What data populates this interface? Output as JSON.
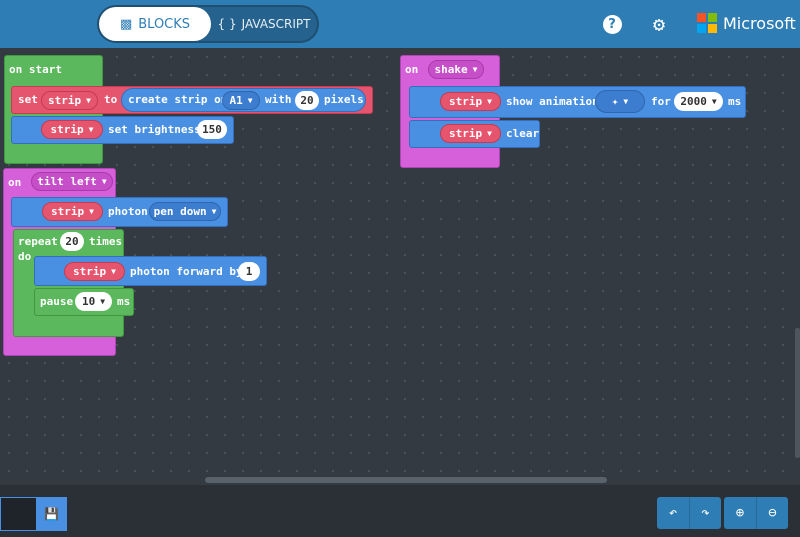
{
  "header": {
    "blocks_label": "BLOCKS",
    "javascript_label": "JAVASCRIPT",
    "brand": "Microsoft",
    "brand_colors": [
      "#f35325",
      "#81bc06",
      "#05a6f0",
      "#ffba08"
    ]
  },
  "blocks": {
    "on_start": {
      "label": "on start",
      "set_block": {
        "set": "set",
        "var": "strip",
        "to": "to",
        "create": "create strip on",
        "pin": "A1",
        "with": "with",
        "count": "20",
        "pixels": "pixels"
      },
      "brightness_block": {
        "var": "strip",
        "label": "set brightness",
        "value": "150"
      }
    },
    "on_shake": {
      "on": "on",
      "event": "shake",
      "show_animation": {
        "var": "strip",
        "label": "show animation",
        "for": "for",
        "duration": "2000",
        "ms": "ms"
      },
      "clear_block": {
        "var": "strip",
        "label": "clear"
      }
    },
    "on_tilt": {
      "on": "on",
      "event": "tilt left",
      "photon_block": {
        "var": "strip",
        "label": "photon",
        "mode": "pen down"
      },
      "repeat_block": {
        "repeat": "repeat",
        "count": "20",
        "times": "times",
        "do": "do",
        "forward_block": {
          "var": "strip",
          "label": "photon forward by",
          "value": "1"
        },
        "pause_block": {
          "label": "pause",
          "value": "10",
          "ms": "ms"
        }
      }
    }
  },
  "colors": {
    "header": "#2e7eb5",
    "workspace": "#333a41",
    "loops": "#5cb85c",
    "input": "#d660d9",
    "light": "#4a90e2",
    "variables": "#e5556d"
  }
}
